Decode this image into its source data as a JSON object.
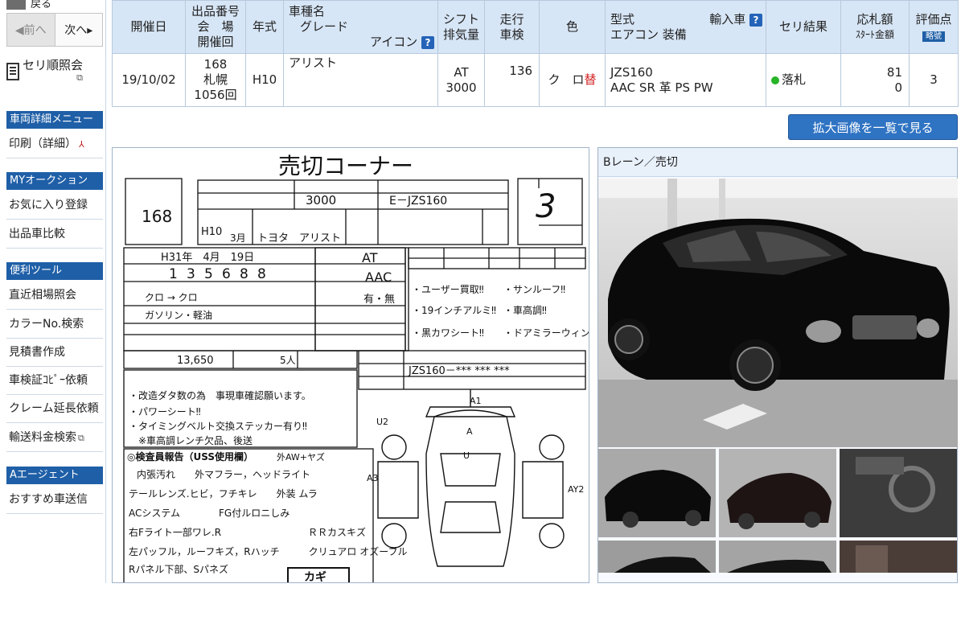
{
  "sidebar": {
    "back": "戻る",
    "prev": "◀前へ",
    "next": "次へ▸",
    "seri_label": "セリ順照会",
    "sections": [
      {
        "head": "車両詳細メニュー",
        "items": [
          "印刷（詳細）"
        ]
      },
      {
        "head": "MYオークション",
        "items": [
          "お気に入り登録",
          "出品車比較"
        ]
      },
      {
        "head": "便利ツール",
        "items": [
          "直近相場照会",
          "カラーNo.検索",
          "見積書作成",
          "車検証ｺﾋﾟｰ依頼",
          "クレーム延長依頼",
          "輸送料金検索"
        ]
      },
      {
        "head": "Aエージェント",
        "items": [
          "おすすめ車送信"
        ]
      }
    ]
  },
  "header": {
    "cols": {
      "date": "開催日",
      "lot_l1": "出品番号",
      "lot_l2": "会　場",
      "lot_l3": "開催回",
      "year": "年式",
      "name_l1": "車種名",
      "name_l2": "グレード",
      "name_l3": "アイコン",
      "shift_l1": "シフト",
      "shift_l2": "排気量",
      "mileage_l1": "走行",
      "mileage_l2": "車検",
      "color": "色",
      "type_l1": "型式",
      "type_import": "輸入車",
      "type_l2": "エアコン 装備",
      "result": "セリ結果",
      "bid_l1": "応札額",
      "bid_l2": "ｽﾀｰﾄ金額",
      "score": "評価点",
      "score_badge": "略號"
    },
    "row": {
      "date": "19/10/02",
      "lot": "168",
      "venue": "札幌",
      "session": "1056回",
      "year": "H10",
      "name": "アリスト",
      "shift": "AT",
      "displacement": "3000",
      "mileage": "136",
      "color": "ク　ロ",
      "color_mark": "替",
      "model": "JZS160",
      "equipment": "AAC SR 革 PS PW",
      "result": "落札",
      "bid_1": "81",
      "bid_2": "0",
      "score": "3"
    }
  },
  "enlarge_button": "拡大画像を一覧で見る",
  "sheet": {
    "title": "売切コーナー",
    "lot_no": "168",
    "score": "3",
    "displacement": "3000",
    "model_code": "E－JZS160",
    "year": "H10",
    "month": "3月",
    "maker_name": "トヨタ　アリスト",
    "inspect": "H31年　4月　19日",
    "odometer": [
      "1",
      "3",
      "5",
      "6",
      "8",
      "8"
    ],
    "shift": "AT",
    "aircon": "AAC",
    "ac_check": "有・無",
    "color_text": "クロ → クロ",
    "fuel": "ガソリン・軽油",
    "seats": "5人",
    "recycle": "13,650",
    "chassis": "JZS160－*** *** ***",
    "sales_points": [
      "・ユーザー買取‼",
      "・サンルーフ‼",
      "・19インチアルミ‼",
      "・車高調‼",
      "・黒カワシート‼",
      "・ドアミラーウィンカー"
    ],
    "notes": [
      "・改造ダタ数の為　事現車確認願います。",
      "・パワーシート‼",
      "・タイミングベルト交換ステッカー有り‼",
      "　※車高調レンチ欠品、後送"
    ],
    "inspector_title": "◎検査員報告（USS使用欄）",
    "inspector_sub": "外AW+ヤズ",
    "inspector_lines": [
      "内張汚れ　　外マフラー，ヘッドライト",
      "テールレンズ.ヒビ，フチキレ　　外装 ムラ",
      "ACシステム　　　　FG付ルロニしみ",
      "右Fライト一部ワレ.R　　　　　　　　　ＲＲカスキズ",
      "左パッフル，ルーフキズ，Rハッチ　　　クリュアロ オズーフル",
      "Rパネル下部、Sパネズ"
    ],
    "dents": [
      "A",
      "U",
      "U2",
      "A3",
      "A1",
      "AY2"
    ],
    "key_stamp": "カギ"
  },
  "photos": {
    "lane": "Bレーン／売切"
  }
}
